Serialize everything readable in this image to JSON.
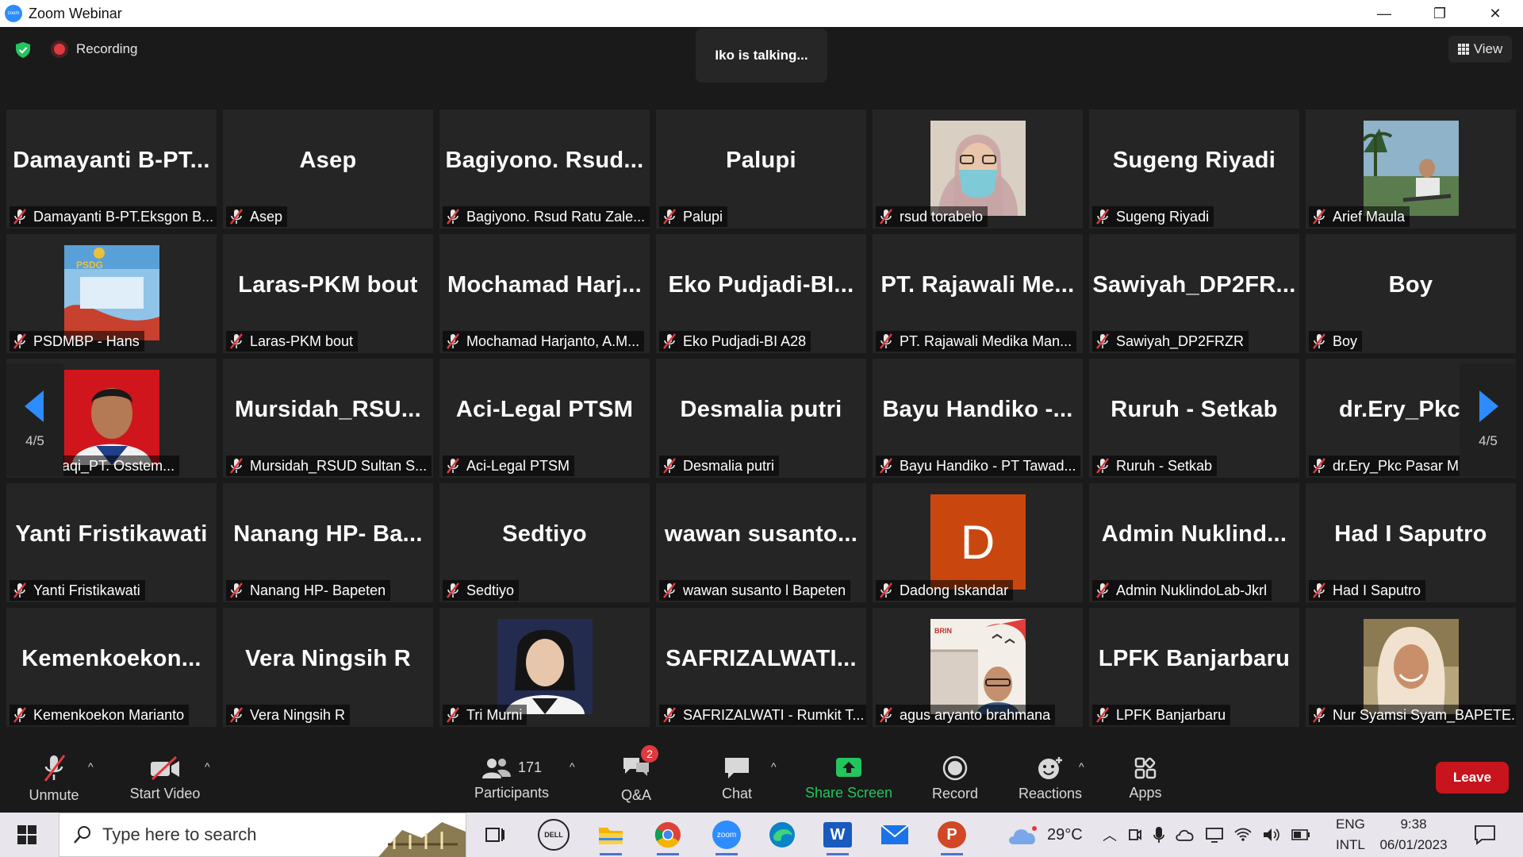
{
  "window": {
    "title": "Zoom Webinar",
    "logo_text": "zoom",
    "min": "—",
    "restore": "❐",
    "close": "✕"
  },
  "header": {
    "recording_label": "Recording",
    "talking": "Iko is talking...",
    "view_label": "View"
  },
  "pager": {
    "left": "4/5",
    "right": "4/5"
  },
  "tiles": [
    {
      "big": "Damayanti  B-PT...",
      "caption": "Damayanti B-PT.Eksgon B..."
    },
    {
      "big": "Asep",
      "caption": "Asep"
    },
    {
      "big": "Bagiyono.  Rsud...",
      "caption": "Bagiyono. Rsud Ratu Zale..."
    },
    {
      "big": "Palupi",
      "caption": "Palupi"
    },
    {
      "big": "",
      "caption": "rsud torabelo",
      "photo": "woman-mask"
    },
    {
      "big": "Sugeng Riyadi",
      "caption": "Sugeng Riyadi"
    },
    {
      "big": "",
      "caption": "Arief Maula",
      "photo": "outdoor"
    },
    {
      "big": "",
      "caption": "PSDMBP - Hans",
      "photo": "poster",
      "photo_text": "PSDG"
    },
    {
      "big": "Laras-PKM bout",
      "caption": "Laras-PKM bout"
    },
    {
      "big": "Mochamad  Harj...",
      "caption": "Mochamad Harjanto, A.M..."
    },
    {
      "big": "Eko  Pudjadi-BI...",
      "caption": "Eko Pudjadi-BI A28"
    },
    {
      "big": "PT.  Rajawali  Me...",
      "caption": "PT. Rajawali Medika Man..."
    },
    {
      "big": "Sawiyah_DP2FR...",
      "caption": "Sawiyah_DP2FRZR"
    },
    {
      "big": "Boy",
      "caption": "Boy"
    },
    {
      "big": "",
      "caption": "Baihaqi_PT. Osstem...",
      "photo": "man-red"
    },
    {
      "big": "Mursidah_RSU...",
      "caption": "Mursidah_RSUD Sultan S..."
    },
    {
      "big": "Aci-Legal PTSM",
      "caption": "Aci-Legal PTSM"
    },
    {
      "big": "Desmalia putri",
      "caption": "Desmalia putri"
    },
    {
      "big": "Bayu Handiko  -...",
      "caption": "Bayu Handiko - PT Tawad..."
    },
    {
      "big": "Ruruh - Setkab",
      "caption": "Ruruh - Setkab"
    },
    {
      "big": "dr.Ery_Pkc  P",
      "caption": "dr.Ery_Pkc Pasar M"
    },
    {
      "big": "Yanti Fristikawati",
      "caption": "Yanti Fristikawati"
    },
    {
      "big": "Nanang  HP-  Ba...",
      "caption": "Nanang HP- Bapeten"
    },
    {
      "big": "Sedtiyo",
      "caption": "Sedtiyo"
    },
    {
      "big": "wawan  susanto...",
      "caption": "wawan susanto l Bapeten"
    },
    {
      "big": "",
      "caption": "Dadong Iskandar",
      "photo": "initial",
      "initial": "D"
    },
    {
      "big": "Admin  Nuklind...",
      "caption": "Admin NuklindoLab-Jkrl"
    },
    {
      "big": "Had I Saputro",
      "caption": "Had I Saputro"
    },
    {
      "big": "Kemenkoekon...",
      "caption": "Kemenkoekon Marianto"
    },
    {
      "big": "Vera Ningsih R",
      "caption": "Vera Ningsih R"
    },
    {
      "big": "",
      "caption": "Tri Murni",
      "photo": "woman-dark"
    },
    {
      "big": "SAFRIZALWATI...",
      "caption": "SAFRIZALWATI - Rumkit T..."
    },
    {
      "big": "",
      "caption": "agus aryanto brahmana",
      "photo": "brin",
      "photo_text": "BRIN"
    },
    {
      "big": "LPFK Banjarbaru",
      "caption": "LPFK Banjarbaru"
    },
    {
      "big": "",
      "caption": "Nur Syamsi Syam_BAPETE...",
      "photo": "hijab"
    }
  ],
  "toolbar": {
    "unmute": "Unmute",
    "start_video": "Start Video",
    "participants": "Participants",
    "participants_count": "171",
    "qa": "Q&A",
    "qa_badge": "2",
    "chat": "Chat",
    "share_screen": "Share Screen",
    "record": "Record",
    "reactions": "Reactions",
    "apps": "Apps",
    "leave": "Leave"
  },
  "taskbar": {
    "search_placeholder": "Type here to search",
    "weather": "29°C",
    "lang_top": "ENG",
    "lang_bottom": "INTL",
    "time": "9:38",
    "date": "06/01/2023",
    "dell_text": "DELL",
    "zoom_text": "zoom",
    "word_text": "W",
    "ppt_text": "P"
  },
  "colors": {
    "accent_green": "#22c55e",
    "leave_red": "#c8141c",
    "zoom_blue": "#2d8cff",
    "muted_red": "#e0393e"
  }
}
